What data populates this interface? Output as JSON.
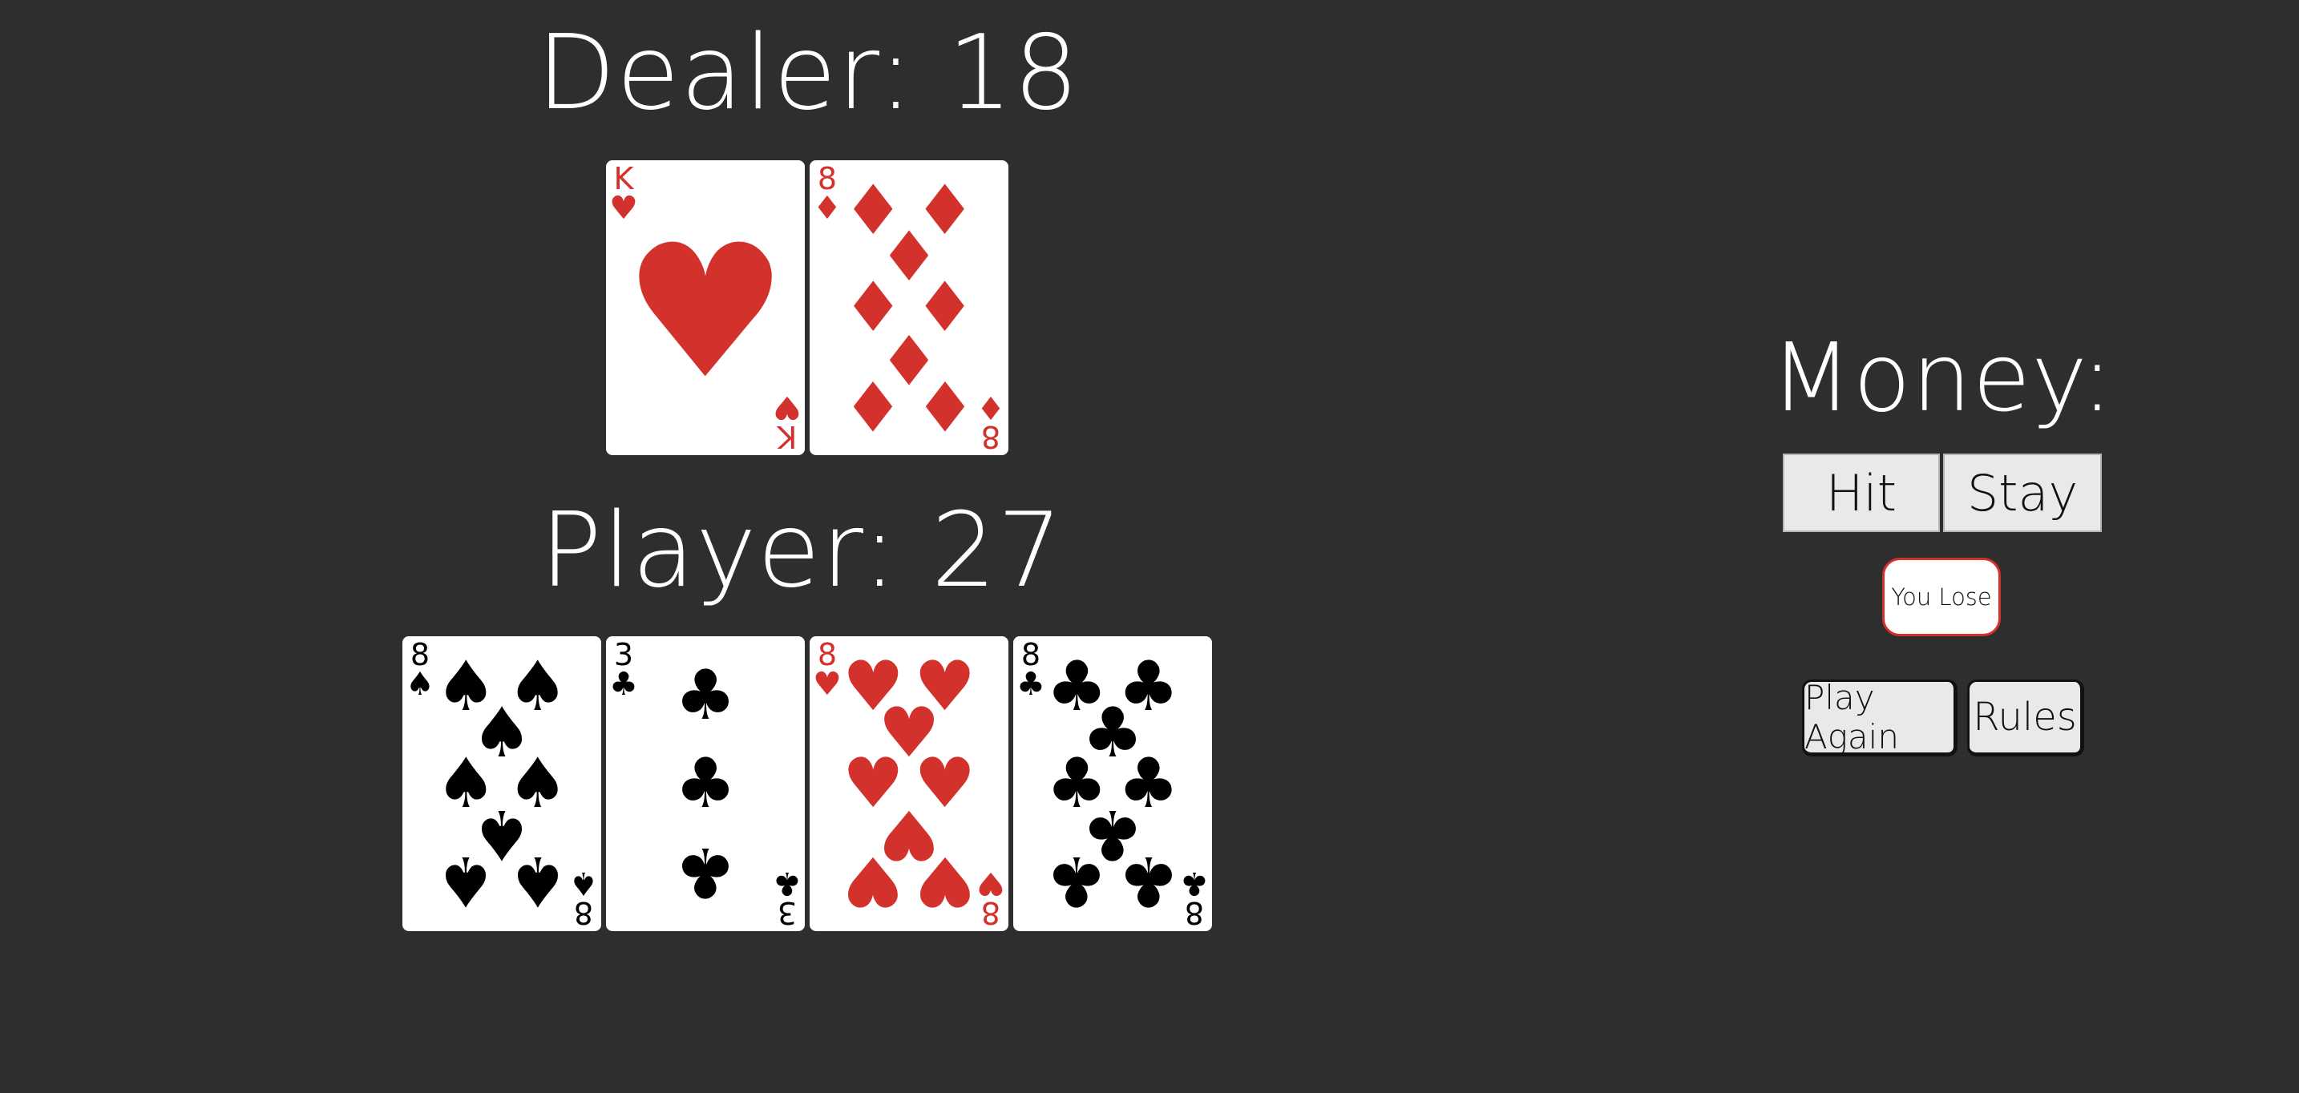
{
  "dealer": {
    "label": "Dealer: 18"
  },
  "player": {
    "label": "Player: 27"
  },
  "money": {
    "label": "Money:"
  },
  "controls": {
    "hit": "Hit",
    "stay": "Stay",
    "play_again": "Play Again",
    "rules": "Rules"
  },
  "status": {
    "text": "You Lose"
  },
  "colors": {
    "background": "#2e2e2e",
    "red_suit": "#d3312b",
    "black_suit": "#000000"
  },
  "cards": {
    "dealer": [
      {
        "rank": "K",
        "suit": "hearts",
        "suit_symbol": "♥",
        "color": "red"
      },
      {
        "rank": "8",
        "suit": "diamonds",
        "suit_symbol": "♦",
        "color": "red"
      }
    ],
    "player": [
      {
        "rank": "8",
        "suit": "spades",
        "suit_symbol": "♠",
        "color": "black"
      },
      {
        "rank": "3",
        "suit": "clubs",
        "suit_symbol": "♣",
        "color": "black"
      },
      {
        "rank": "8",
        "suit": "hearts",
        "suit_symbol": "♥",
        "color": "red"
      },
      {
        "rank": "8",
        "suit": "clubs",
        "suit_symbol": "♣",
        "color": "black"
      }
    ]
  }
}
